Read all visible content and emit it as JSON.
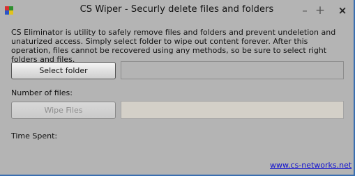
{
  "window": {
    "title": "CS Wiper - Securly delete files and folders",
    "controls": {
      "minimize": "–",
      "maximize": "+",
      "close": "×"
    }
  },
  "description": "CS Eliminator is utility to safely remove files and folders and prevent undeletion and unaturized access. Simply select folder to wipe out content forever. After this operation, files cannot be recovered using any methods, so be sure to select right folders and files.",
  "select_folder_button": "Select folder",
  "folder_path_value": "",
  "number_of_files_label": "Number of files:",
  "wipe_files_button": "Wipe Files",
  "wipe_progress": 0,
  "time_spent_label": "Time Spent:",
  "website_link": "www.cs-networks.net"
}
